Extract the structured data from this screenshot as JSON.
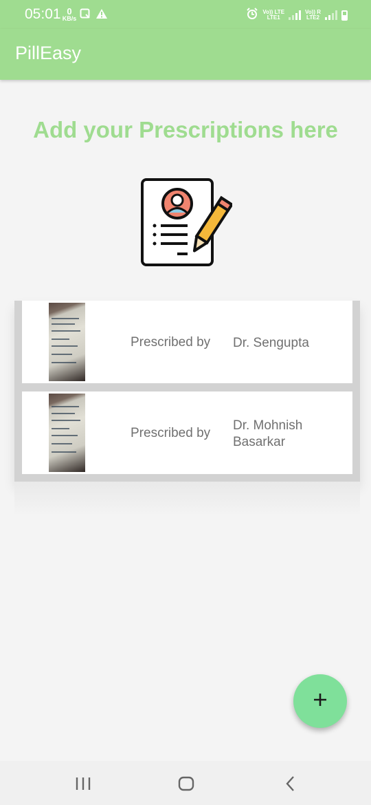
{
  "status_bar": {
    "time": "05:01",
    "net_speed_value": "0",
    "net_speed_unit": "KB/s",
    "sim1_label": "Vo)) LTE",
    "sim1_sub": "LTE1",
    "sim2_label": "Vo)) R",
    "sim2_sub": "LTE2",
    "icons": [
      "data-saver-icon",
      "warning-icon",
      "alarm-icon",
      "signal-icon",
      "battery-icon"
    ]
  },
  "app_bar": {
    "title": "PillEasy"
  },
  "main": {
    "heading": "Add your Prescriptions here",
    "illustration": "prescription-document-pencil-icon"
  },
  "prescriptions": [
    {
      "label": "Prescribed by",
      "doctor": "Dr. Sengupta"
    },
    {
      "label": "Prescribed by",
      "doctor": "Dr. Mohnish Basarkar"
    }
  ],
  "fab": {
    "icon": "plus-icon"
  },
  "nav_bar": {
    "icons": [
      "recent-apps-icon",
      "home-icon",
      "back-icon"
    ]
  },
  "colors": {
    "primary": "#9fdc90",
    "fab": "#7fe09a",
    "text_muted": "#707070",
    "background": "#f4f4f4"
  }
}
